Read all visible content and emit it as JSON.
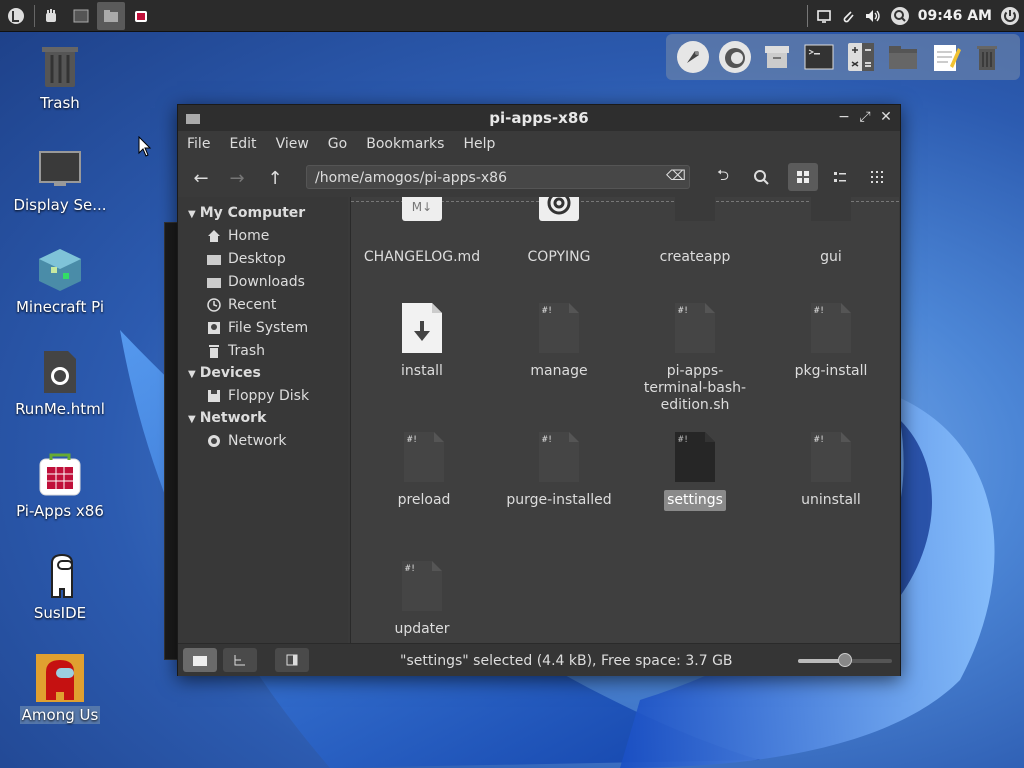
{
  "panel": {
    "clock": "09:46 AM"
  },
  "desktop_icons": [
    {
      "label": "Trash",
      "icon": "trash-icon"
    },
    {
      "label": "Display Se...",
      "icon": "monitor-icon"
    },
    {
      "label": "Minecraft Pi",
      "icon": "minecraft-icon"
    },
    {
      "label": "RunMe.html",
      "icon": "html-file-icon"
    },
    {
      "label": "Pi-Apps x86",
      "icon": "pi-apps-icon"
    },
    {
      "label": "SusIDE",
      "icon": "amogus-outline-icon"
    },
    {
      "label": "Among Us",
      "icon": "among-us-icon"
    }
  ],
  "window": {
    "title": "pi-apps-x86",
    "menu": [
      "File",
      "Edit",
      "View",
      "Go",
      "Bookmarks",
      "Help"
    ],
    "path": "/home/amogos/pi-apps-x86"
  },
  "sidebar": {
    "my_computer": "My Computer",
    "my_computer_items": [
      "Home",
      "Desktop",
      "Downloads",
      "Recent",
      "File System",
      "Trash"
    ],
    "devices": "Devices",
    "device_items": [
      "Floppy Disk"
    ],
    "network": "Network",
    "network_items": [
      "Network"
    ]
  },
  "files": [
    {
      "name": "CHANGELOG.md",
      "type": "markdown"
    },
    {
      "name": "COPYING",
      "type": "license"
    },
    {
      "name": "createapp",
      "type": "script"
    },
    {
      "name": "gui",
      "type": "script"
    },
    {
      "name": "install",
      "type": "installer"
    },
    {
      "name": "manage",
      "type": "script"
    },
    {
      "name": "pi-apps-terminal-bash-edition.sh",
      "type": "script"
    },
    {
      "name": "pkg-install",
      "type": "script"
    },
    {
      "name": "preload",
      "type": "script"
    },
    {
      "name": "purge-installed",
      "type": "script"
    },
    {
      "name": "settings",
      "type": "script",
      "selected": true
    },
    {
      "name": "uninstall",
      "type": "script"
    },
    {
      "name": "updater",
      "type": "script"
    }
  ],
  "file_labels": {
    "pi_apps_line1": "pi-apps-",
    "pi_apps_line2": "terminal-bash-",
    "pi_apps_line3": "edition.sh"
  },
  "status": {
    "text": "\"settings\" selected (4.4 kB), Free space: 3.7 GB",
    "zoom_fraction": 0.5
  },
  "colors": {
    "selection": "#8a8a8a",
    "panel": "#2b2b2b",
    "window": "#3a3a3a"
  }
}
